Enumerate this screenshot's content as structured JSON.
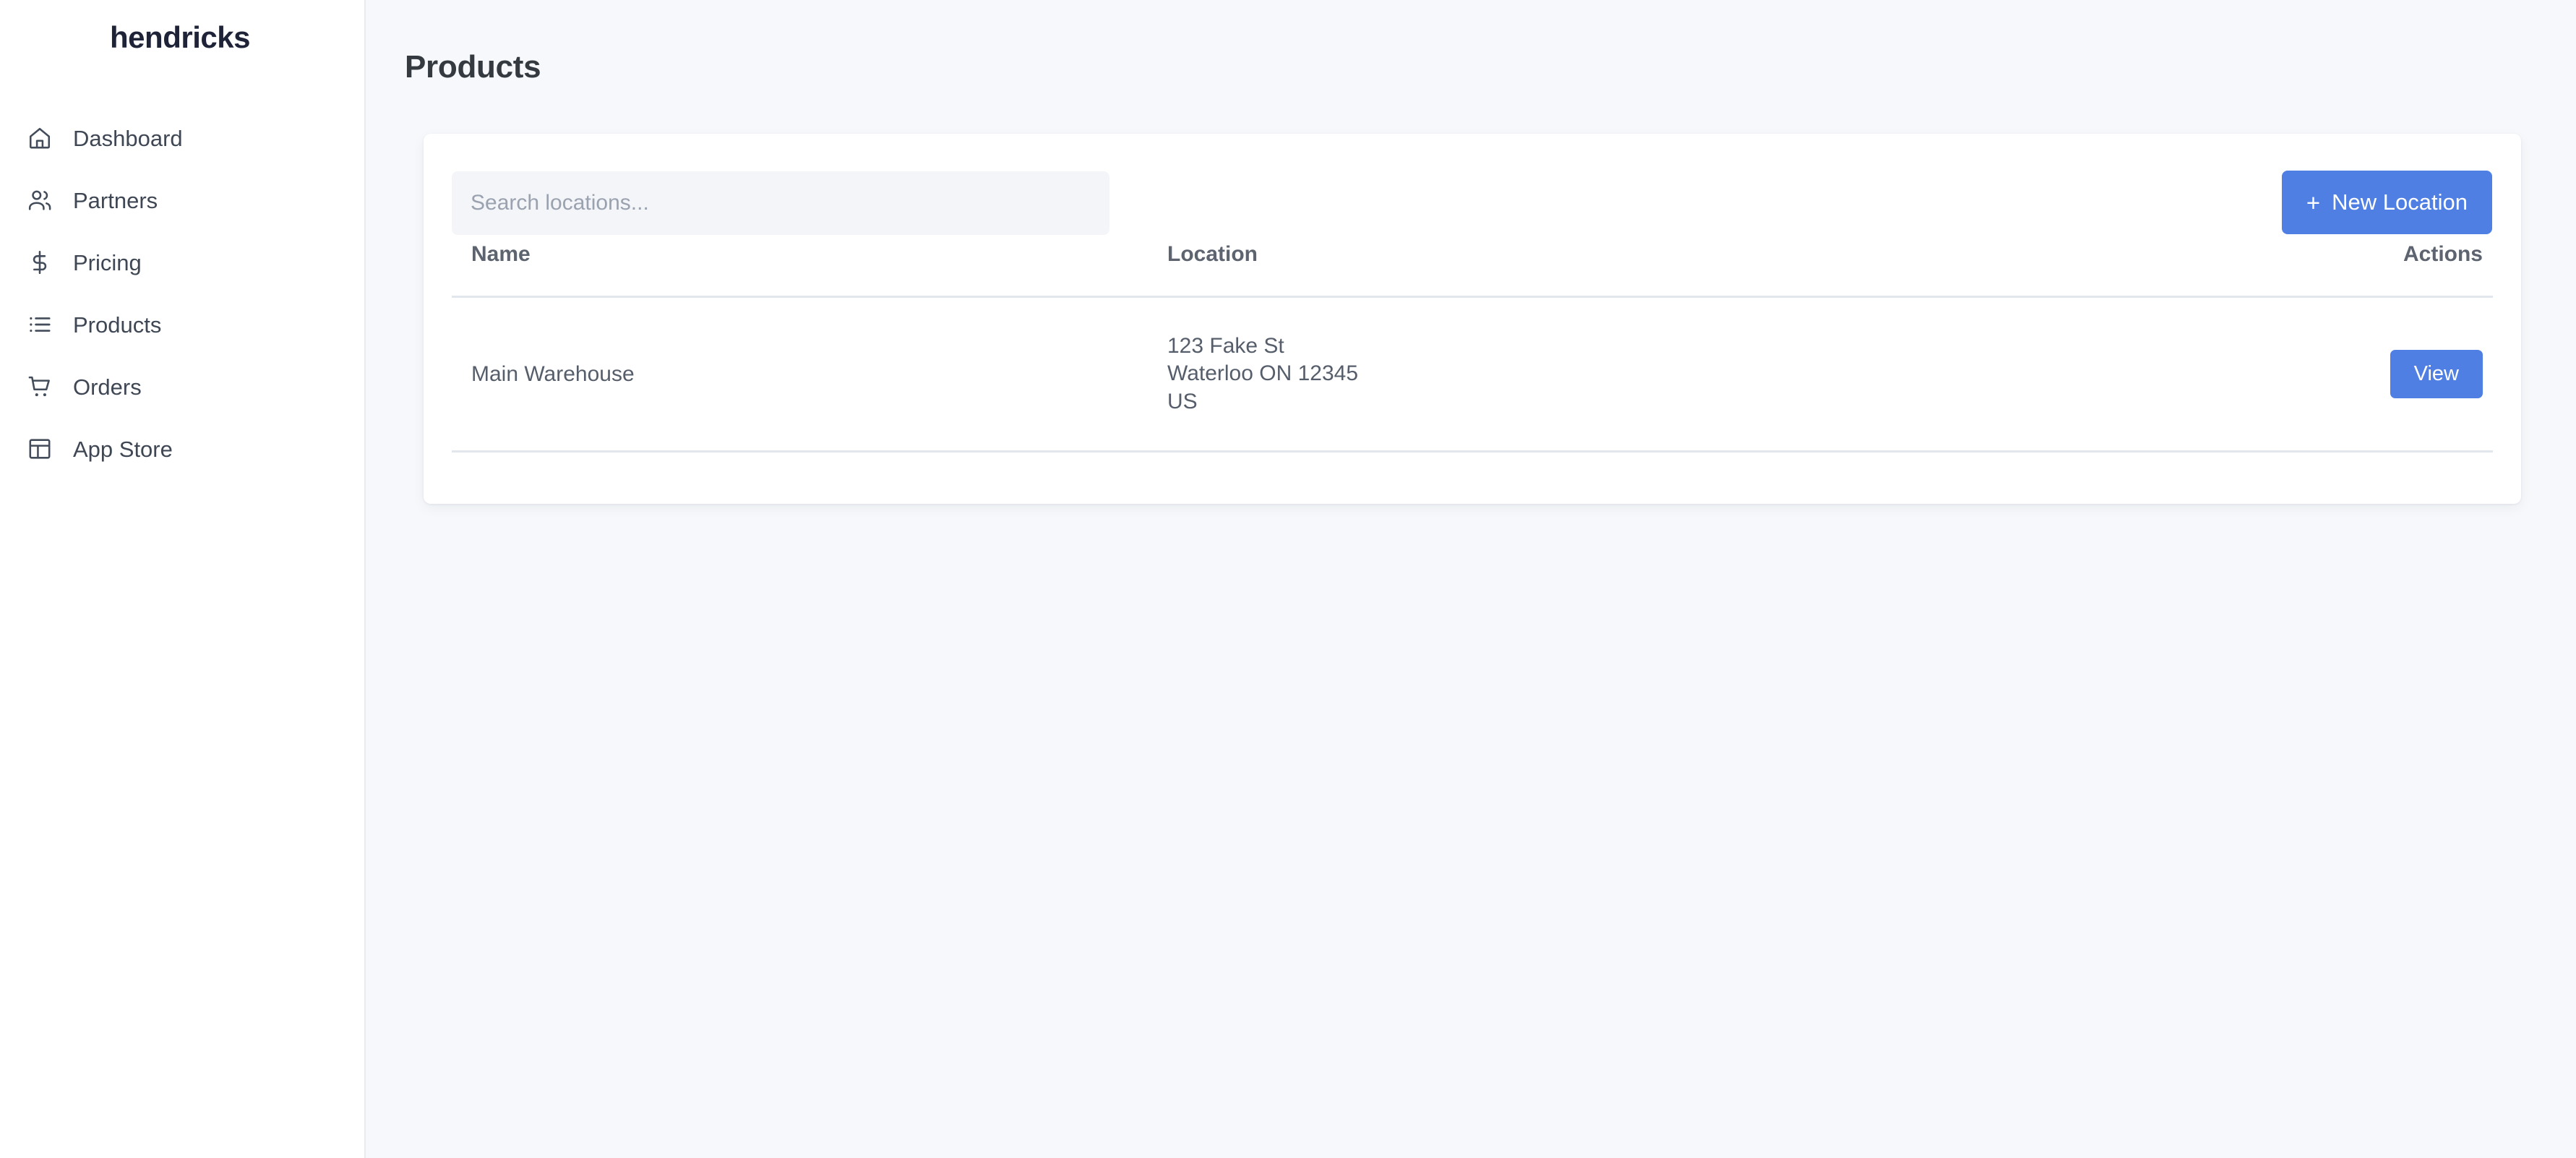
{
  "sidebar": {
    "brand": "hendricks",
    "items": [
      {
        "label": "Dashboard",
        "icon": "home-icon"
      },
      {
        "label": "Partners",
        "icon": "users-icon"
      },
      {
        "label": "Pricing",
        "icon": "dollar-icon"
      },
      {
        "label": "Products",
        "icon": "list-icon"
      },
      {
        "label": "Orders",
        "icon": "cart-icon"
      },
      {
        "label": "App Store",
        "icon": "layout-icon"
      }
    ]
  },
  "page": {
    "title": "Products"
  },
  "toolbar": {
    "search_value": "",
    "search_placeholder": "Search locations...",
    "new_button_label": "New Location",
    "new_button_plus": "+"
  },
  "table": {
    "headers": {
      "name": "Name",
      "location": "Location",
      "actions": "Actions"
    },
    "rows": [
      {
        "name": "Main Warehouse",
        "address_line1": "123 Fake St",
        "address_line2": "Waterloo ON 12345",
        "address_line3": "US",
        "action_label": "View"
      }
    ]
  },
  "colors": {
    "accent": "#4f7fe3",
    "brand_text": "#1f2337",
    "page_bg": "#f6f8fb",
    "card_bg": "#ffffff",
    "border": "#e2e6ed"
  }
}
